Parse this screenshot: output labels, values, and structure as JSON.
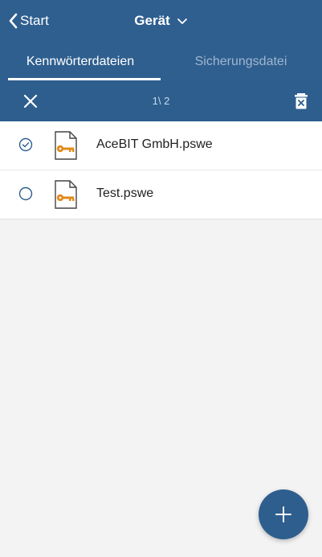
{
  "header": {
    "back_label": "Start",
    "title": "Gerät"
  },
  "tabs": [
    {
      "label": "Kennwörterdateien",
      "active": true
    },
    {
      "label": "Sicherungsdatei",
      "active": false
    }
  ],
  "selection": {
    "count_text": "1\\ 2"
  },
  "files": [
    {
      "name": "AceBIT GmbH.pswe",
      "selected": true
    },
    {
      "name": "Test.pswe",
      "selected": false
    }
  ],
  "colors": {
    "primary": "#2f5f8f",
    "accent": "#2d5e8e",
    "key_icon": "#e08a1a",
    "background": "#f3f3f3"
  },
  "icons": {
    "back": "chevron-left-icon",
    "title_dropdown": "chevron-down-icon",
    "close": "close-icon",
    "delete": "trash-icon",
    "file": "key-file-icon",
    "add": "plus-icon"
  }
}
